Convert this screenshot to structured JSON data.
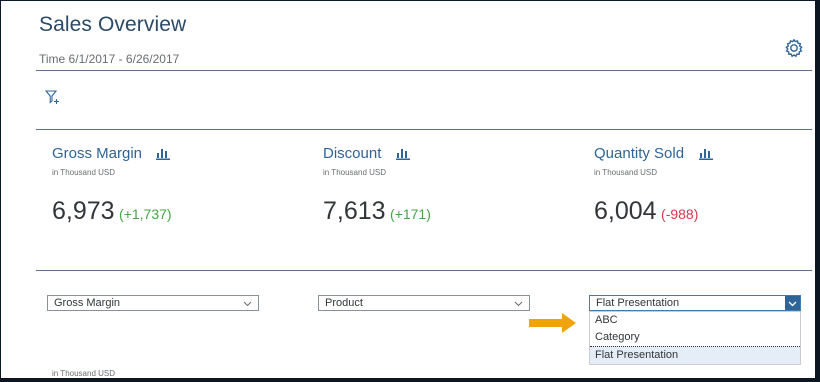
{
  "header": {
    "title": "Sales Overview",
    "subtitle": "Time 6/1/2017 - 6/26/2017",
    "settings_icon": "gear-icon",
    "filter_icon": "filter-add-icon"
  },
  "kpis": [
    {
      "title": "Gross Margin",
      "unit": "in Thousand USD",
      "value": "6,973",
      "delta": "+1,737",
      "delta_sign": "positive",
      "icon": "bar-chart-icon"
    },
    {
      "title": "Discount",
      "unit": "in Thousand USD",
      "value": "7,613",
      "delta": "+171",
      "delta_sign": "positive",
      "icon": "bar-chart-icon"
    },
    {
      "title": "Quantity Sold",
      "unit": "in Thousand USD",
      "value": "6,004",
      "delta": "-988",
      "delta_sign": "negative",
      "icon": "bar-chart-icon"
    }
  ],
  "selects": {
    "measure": {
      "value": "Gross Margin"
    },
    "dimension": {
      "value": "Product"
    },
    "presentation": {
      "value": "Flat Presentation",
      "options": [
        "ABC",
        "Category",
        "Flat Presentation"
      ],
      "selected_index": 2
    }
  },
  "footer": {
    "unit": "in Thousand USD"
  },
  "colors": {
    "title": "#2b4a66",
    "kpi_title": "#2f6497",
    "positive": "#47a447",
    "negative": "#d9364c",
    "arrow": "#f0a30a"
  }
}
